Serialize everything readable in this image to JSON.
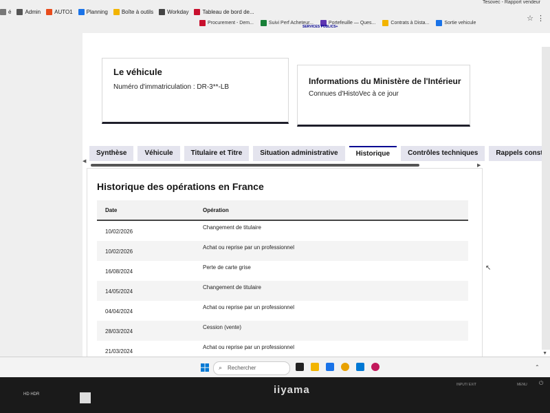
{
  "window": {
    "title": "Tesovec - Rapport vendeur"
  },
  "bookmarks_row1": [
    {
      "label": "é",
      "color": "#777777"
    },
    {
      "label": "Admin",
      "color": "#555555"
    },
    {
      "label": "AUTO1",
      "color": "#e84c1c"
    },
    {
      "label": "Planning",
      "color": "#1a73e8"
    },
    {
      "label": "Boîte à outils",
      "color": "#f2b400"
    },
    {
      "label": "Workday",
      "color": "#444444"
    },
    {
      "label": "Tableau de bord de...",
      "color": "#c8102e"
    }
  ],
  "bookmarks_row2": [
    {
      "label": "Procurement - Dem...",
      "color": "#c8102e"
    },
    {
      "label": "Suivi Perf Acheteur...",
      "color": "#188038"
    },
    {
      "label": "Portefeuille — Ques...",
      "color": "#5e35b1"
    },
    {
      "label": "Contrats à Dista...",
      "color": "#f2b400"
    },
    {
      "label": "Sortie vehicule",
      "color": "#1a73e8"
    }
  ],
  "services_logo": "SERVICES PUBLICS+",
  "vehicle_card": {
    "title": "Le véhicule",
    "subtitle": "Numéro d'immatriculation : DR-3**-LB"
  },
  "ministry_card": {
    "title": "Informations du Ministère de l'Intérieur",
    "subtitle": "Connues d'HistoVec à ce jour"
  },
  "tabs": [
    {
      "label": "Synthèse"
    },
    {
      "label": "Véhicule"
    },
    {
      "label": "Titulaire et Titre"
    },
    {
      "label": "Situation administrative"
    },
    {
      "label": "Historique",
      "active": true
    },
    {
      "label": "Contrôles techniques"
    },
    {
      "label": "Rappels construc"
    }
  ],
  "history": {
    "title": "Historique des opérations en France",
    "col_date": "Date",
    "col_operation": "Opération",
    "rows": [
      {
        "date": "10/02/2026",
        "operation": "Changement de titulaire"
      },
      {
        "date": "10/02/2026",
        "operation": "Achat ou reprise par un professionnel"
      },
      {
        "date": "16/08/2024",
        "operation": "Perte de carte grise"
      },
      {
        "date": "14/05/2024",
        "operation": "Changement de titulaire"
      },
      {
        "date": "04/04/2024",
        "operation": "Achat ou reprise par un professionnel"
      },
      {
        "date": "28/03/2024",
        "operation": "Cession (vente)"
      },
      {
        "date": "21/03/2024",
        "operation": "Achat ou reprise par un professionnel"
      }
    ]
  },
  "taskbar": {
    "search_label": "Rechercher"
  },
  "monitor": {
    "brand": "iiyama",
    "input_label": "INPUT/ EXIT",
    "menu_label": "MENU",
    "left_logos": "HD HDR"
  },
  "colors": {
    "accent": "#000091",
    "card_border": "#1e1e2a"
  }
}
